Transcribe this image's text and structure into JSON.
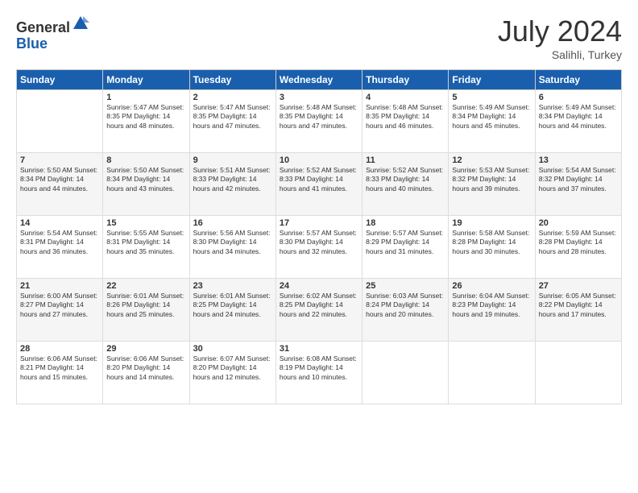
{
  "logo": {
    "general": "General",
    "blue": "Blue"
  },
  "header": {
    "month": "July 2024",
    "location": "Salihli, Turkey"
  },
  "weekdays": [
    "Sunday",
    "Monday",
    "Tuesday",
    "Wednesday",
    "Thursday",
    "Friday",
    "Saturday"
  ],
  "weeks": [
    [
      {
        "day": "",
        "info": ""
      },
      {
        "day": "1",
        "info": "Sunrise: 5:47 AM\nSunset: 8:35 PM\nDaylight: 14 hours\nand 48 minutes."
      },
      {
        "day": "2",
        "info": "Sunrise: 5:47 AM\nSunset: 8:35 PM\nDaylight: 14 hours\nand 47 minutes."
      },
      {
        "day": "3",
        "info": "Sunrise: 5:48 AM\nSunset: 8:35 PM\nDaylight: 14 hours\nand 47 minutes."
      },
      {
        "day": "4",
        "info": "Sunrise: 5:48 AM\nSunset: 8:35 PM\nDaylight: 14 hours\nand 46 minutes."
      },
      {
        "day": "5",
        "info": "Sunrise: 5:49 AM\nSunset: 8:34 PM\nDaylight: 14 hours\nand 45 minutes."
      },
      {
        "day": "6",
        "info": "Sunrise: 5:49 AM\nSunset: 8:34 PM\nDaylight: 14 hours\nand 44 minutes."
      }
    ],
    [
      {
        "day": "7",
        "info": "Sunrise: 5:50 AM\nSunset: 8:34 PM\nDaylight: 14 hours\nand 44 minutes."
      },
      {
        "day": "8",
        "info": "Sunrise: 5:50 AM\nSunset: 8:34 PM\nDaylight: 14 hours\nand 43 minutes."
      },
      {
        "day": "9",
        "info": "Sunrise: 5:51 AM\nSunset: 8:33 PM\nDaylight: 14 hours\nand 42 minutes."
      },
      {
        "day": "10",
        "info": "Sunrise: 5:52 AM\nSunset: 8:33 PM\nDaylight: 14 hours\nand 41 minutes."
      },
      {
        "day": "11",
        "info": "Sunrise: 5:52 AM\nSunset: 8:33 PM\nDaylight: 14 hours\nand 40 minutes."
      },
      {
        "day": "12",
        "info": "Sunrise: 5:53 AM\nSunset: 8:32 PM\nDaylight: 14 hours\nand 39 minutes."
      },
      {
        "day": "13",
        "info": "Sunrise: 5:54 AM\nSunset: 8:32 PM\nDaylight: 14 hours\nand 37 minutes."
      }
    ],
    [
      {
        "day": "14",
        "info": "Sunrise: 5:54 AM\nSunset: 8:31 PM\nDaylight: 14 hours\nand 36 minutes."
      },
      {
        "day": "15",
        "info": "Sunrise: 5:55 AM\nSunset: 8:31 PM\nDaylight: 14 hours\nand 35 minutes."
      },
      {
        "day": "16",
        "info": "Sunrise: 5:56 AM\nSunset: 8:30 PM\nDaylight: 14 hours\nand 34 minutes."
      },
      {
        "day": "17",
        "info": "Sunrise: 5:57 AM\nSunset: 8:30 PM\nDaylight: 14 hours\nand 32 minutes."
      },
      {
        "day": "18",
        "info": "Sunrise: 5:57 AM\nSunset: 8:29 PM\nDaylight: 14 hours\nand 31 minutes."
      },
      {
        "day": "19",
        "info": "Sunrise: 5:58 AM\nSunset: 8:28 PM\nDaylight: 14 hours\nand 30 minutes."
      },
      {
        "day": "20",
        "info": "Sunrise: 5:59 AM\nSunset: 8:28 PM\nDaylight: 14 hours\nand 28 minutes."
      }
    ],
    [
      {
        "day": "21",
        "info": "Sunrise: 6:00 AM\nSunset: 8:27 PM\nDaylight: 14 hours\nand 27 minutes."
      },
      {
        "day": "22",
        "info": "Sunrise: 6:01 AM\nSunset: 8:26 PM\nDaylight: 14 hours\nand 25 minutes."
      },
      {
        "day": "23",
        "info": "Sunrise: 6:01 AM\nSunset: 8:25 PM\nDaylight: 14 hours\nand 24 minutes."
      },
      {
        "day": "24",
        "info": "Sunrise: 6:02 AM\nSunset: 8:25 PM\nDaylight: 14 hours\nand 22 minutes."
      },
      {
        "day": "25",
        "info": "Sunrise: 6:03 AM\nSunset: 8:24 PM\nDaylight: 14 hours\nand 20 minutes."
      },
      {
        "day": "26",
        "info": "Sunrise: 6:04 AM\nSunset: 8:23 PM\nDaylight: 14 hours\nand 19 minutes."
      },
      {
        "day": "27",
        "info": "Sunrise: 6:05 AM\nSunset: 8:22 PM\nDaylight: 14 hours\nand 17 minutes."
      }
    ],
    [
      {
        "day": "28",
        "info": "Sunrise: 6:06 AM\nSunset: 8:21 PM\nDaylight: 14 hours\nand 15 minutes."
      },
      {
        "day": "29",
        "info": "Sunrise: 6:06 AM\nSunset: 8:20 PM\nDaylight: 14 hours\nand 14 minutes."
      },
      {
        "day": "30",
        "info": "Sunrise: 6:07 AM\nSunset: 8:20 PM\nDaylight: 14 hours\nand 12 minutes."
      },
      {
        "day": "31",
        "info": "Sunrise: 6:08 AM\nSunset: 8:19 PM\nDaylight: 14 hours\nand 10 minutes."
      },
      {
        "day": "",
        "info": ""
      },
      {
        "day": "",
        "info": ""
      },
      {
        "day": "",
        "info": ""
      }
    ]
  ]
}
